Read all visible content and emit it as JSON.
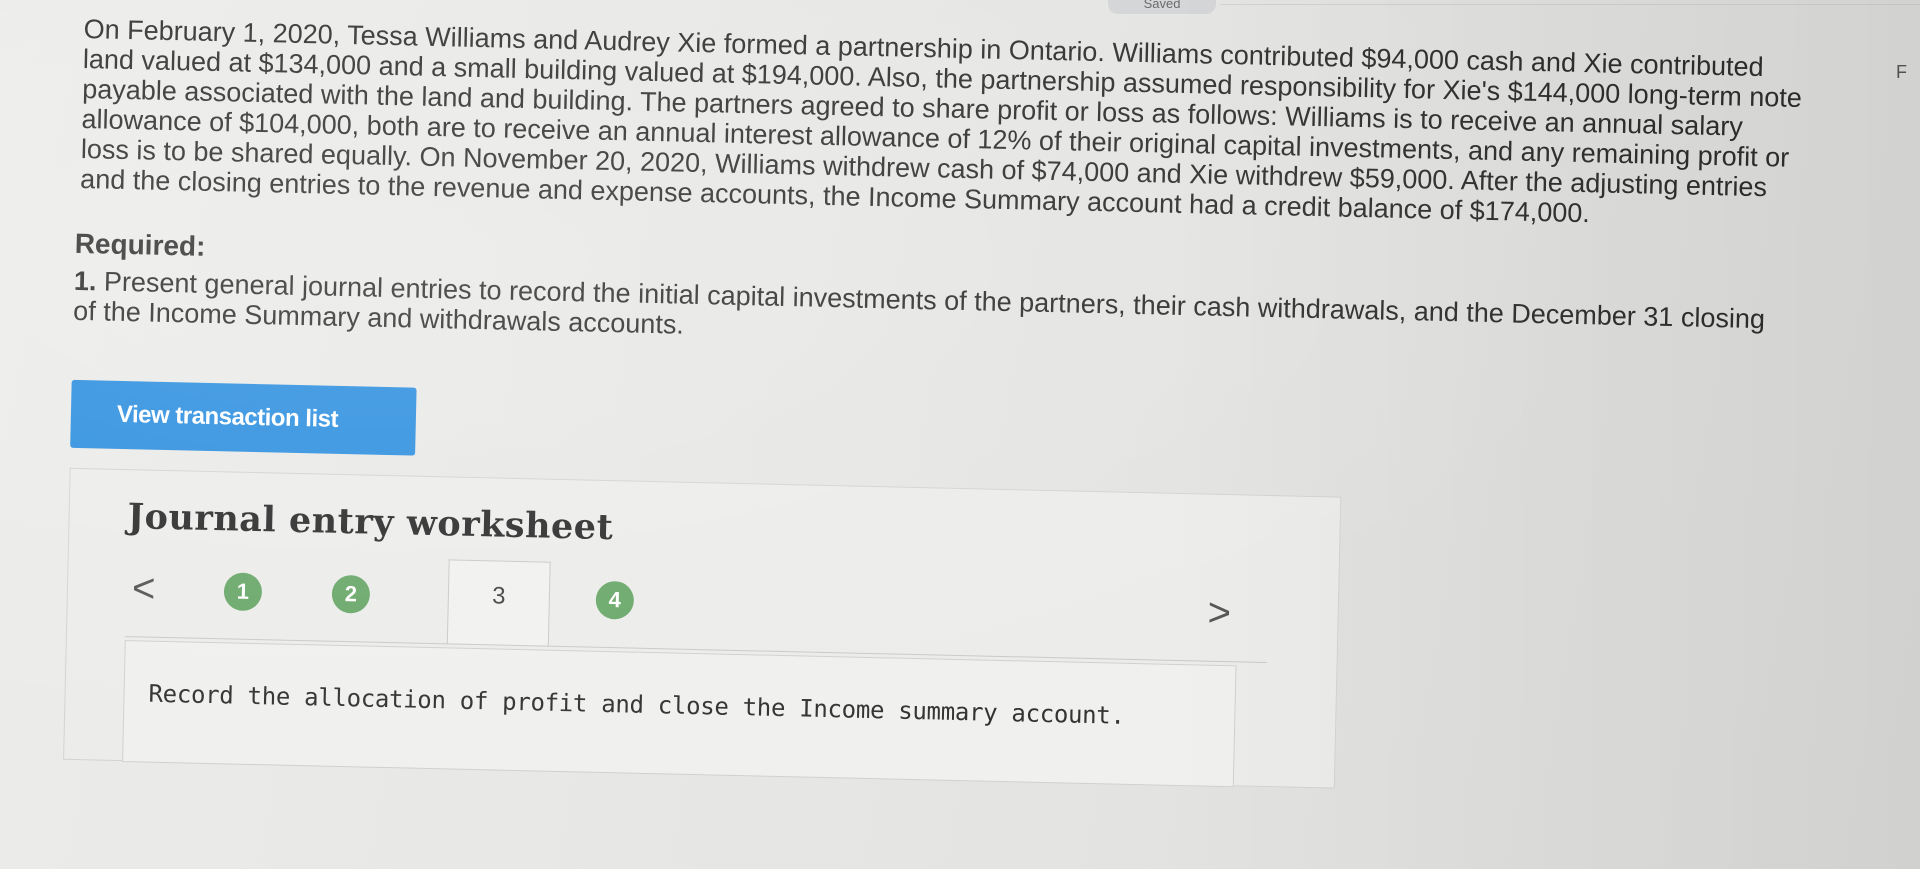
{
  "status": {
    "saved_label": "Saved"
  },
  "problem": {
    "text": "On February 1, 2020, Tessa Williams and Audrey Xie formed a partnership in Ontario. Williams contributed $94,000 cash and Xie contributed land valued at $134,000 and a small building valued at $194,000. Also, the partnership assumed responsibility for Xie's $144,000 long-term note payable associated with the land and building. The partners agreed to share profit or loss as follows: Williams is to receive an annual salary allowance of $104,000, both are to receive an annual interest allowance of 12% of their original capital investments, and any remaining profit or loss is to be shared equally. On November 20, 2020, Williams withdrew cash of $74,000 and Xie withdrew $59,000. After the adjusting entries and the closing entries to the revenue and expense accounts, the Income Summary account had a credit balance of $174,000."
  },
  "required": {
    "title": "Required:",
    "item_number": "1.",
    "item_text": "Present general journal entries to record the initial capital investments of the partners, their cash withdrawals, and the December 31 closing of the Income Summary and withdrawals accounts."
  },
  "buttons": {
    "view_transaction_list": "View transaction list"
  },
  "worksheet": {
    "title": "Journal entry worksheet",
    "prev_arrow": "<",
    "next_arrow": ">",
    "steps": [
      {
        "label": "1",
        "state": "completed"
      },
      {
        "label": "2",
        "state": "completed"
      },
      {
        "label": "3",
        "state": "current"
      },
      {
        "label": "4",
        "state": "completed"
      }
    ],
    "instruction": "Record the allocation of profit and close the Income summary account."
  },
  "edge": {
    "cut_letter": "F"
  },
  "colors": {
    "button_blue": "#2d8fdf",
    "step_green": "#6aa86a",
    "background": "#e6e6e4"
  }
}
